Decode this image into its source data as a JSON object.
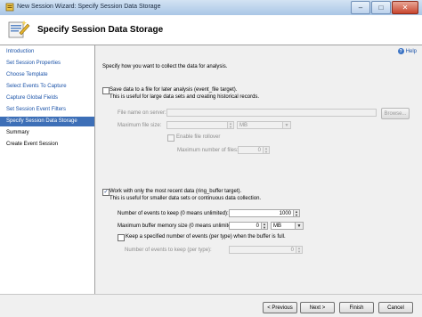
{
  "window": {
    "title": "New Session Wizard: Specify Session Data Storage",
    "controls": {
      "minimize": "–",
      "maximize": "□",
      "close": "✕"
    }
  },
  "header": {
    "title": "Specify Session Data Storage",
    "icon": "wizard-icon"
  },
  "nav": {
    "items": [
      {
        "label": "Introduction",
        "state": "link"
      },
      {
        "label": "Set Session Properties",
        "state": "link"
      },
      {
        "label": "Choose Template",
        "state": "link"
      },
      {
        "label": "Select Events To Capture",
        "state": "link"
      },
      {
        "label": "Capture Global Fields",
        "state": "link"
      },
      {
        "label": "Set Session Event Filters",
        "state": "link"
      },
      {
        "label": "Specify Session Data Storage",
        "state": "active"
      },
      {
        "label": "Summary",
        "state": "plain"
      },
      {
        "label": "Create Event Session",
        "state": "plain"
      }
    ]
  },
  "help": {
    "label": "Help",
    "icon": "help-icon"
  },
  "content": {
    "intro": "Specify how you want to collect the data for analysis.",
    "file_target": {
      "checked": false,
      "label": "Save data to a file for later analysis (event_file target).",
      "description": "This is useful for large data sets and creating historical records.",
      "file_name_label": "File name on server:",
      "file_name_value": "",
      "browse_label": "Browse...",
      "max_size_label": "Maximum file size:",
      "max_size_value": "",
      "max_size_unit": "MB",
      "rollover_checked": false,
      "rollover_label": "Enable file rollover",
      "max_files_label": "Maximum number of files:",
      "max_files_value": "0"
    },
    "ring_buffer": {
      "checked": true,
      "label": "Work with only the most recent data (ring_buffer target).",
      "description": "This is useful for smaller data sets or continuous data collection.",
      "events_to_keep_label": "Number of events to keep (0 means unlimited):",
      "events_to_keep_value": "1000",
      "max_memory_label": "Maximum buffer memory size (0 means unlimited):",
      "max_memory_value": "0",
      "max_memory_unit": "MB",
      "keep_per_type_checked": false,
      "keep_per_type_label": "Keep a specified number of events (per type) when the buffer is full.",
      "per_type_label": "Number of events to keep (per type):",
      "per_type_value": "0"
    }
  },
  "footer": {
    "previous_label": "< Previous",
    "next_label": "Next >",
    "finish_label": "Finish",
    "cancel_label": "Cancel"
  }
}
